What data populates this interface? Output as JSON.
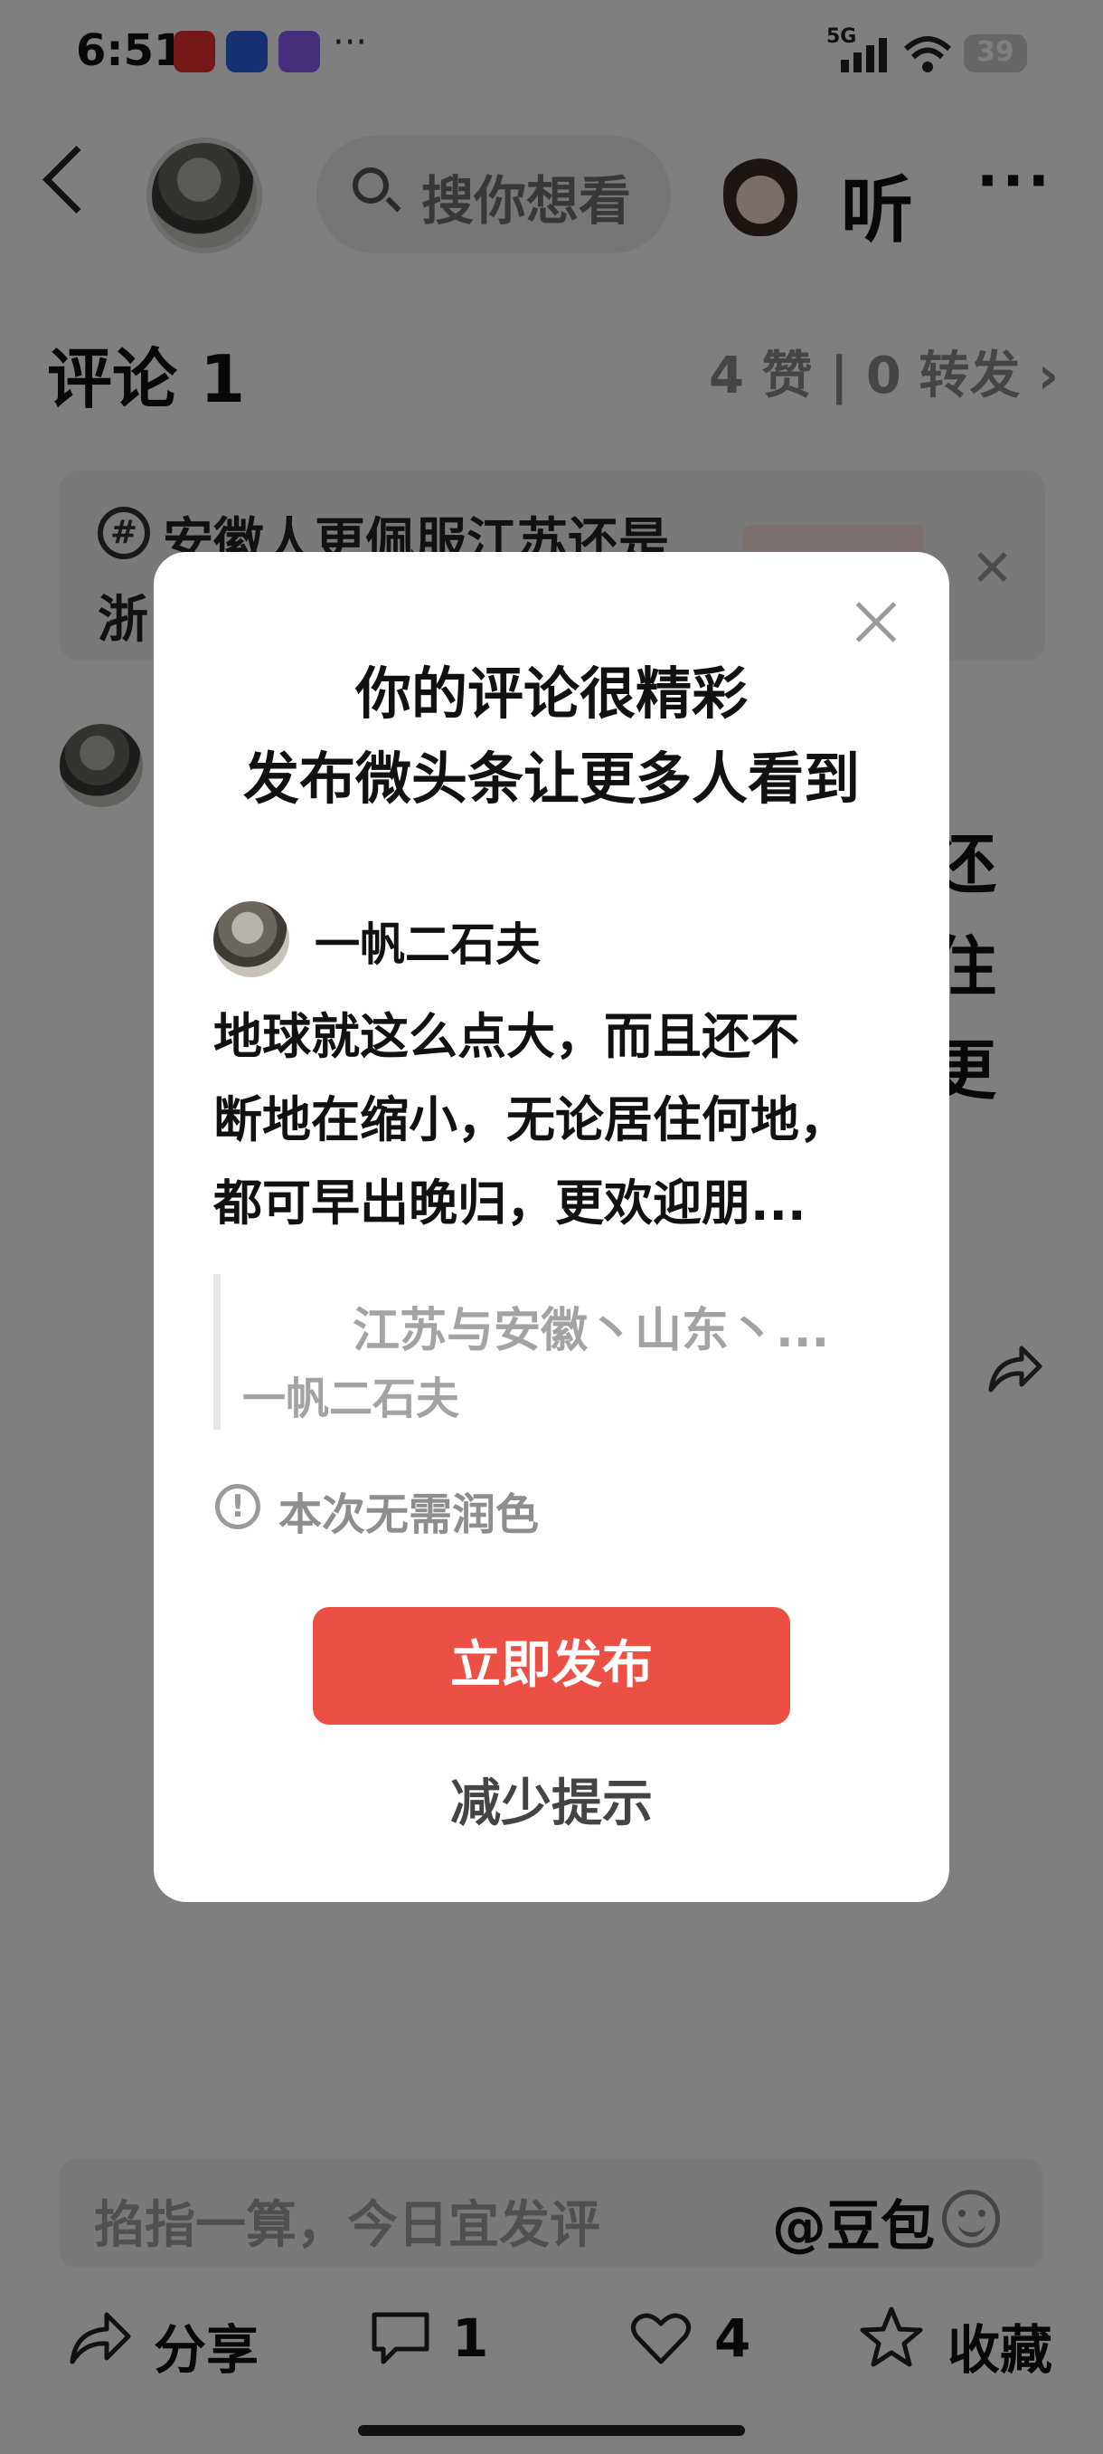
{
  "status_bar": {
    "time": "6:51",
    "app_icons": [
      "toutiao-icon",
      "baidu-icon",
      "upload-icon"
    ],
    "network": "5G",
    "battery": "39"
  },
  "nav": {
    "search_placeholder": "搜你想看",
    "listen_label": "听",
    "more_label": "···"
  },
  "comments": {
    "title": "评论 1",
    "stats": "4 赞 | 0 转发 ›"
  },
  "topic": {
    "line1": "安徽人更佩服江苏还是",
    "line2": "浙"
  },
  "input": {
    "placeholder": "掐指一算，今日宜发评",
    "mention": "@豆包"
  },
  "actions": [
    {
      "label": "分享",
      "icon": "share-icon"
    },
    {
      "label": "1",
      "icon": "comment-icon"
    },
    {
      "label": "4",
      "icon": "heart-icon"
    },
    {
      "label": "收藏",
      "icon": "star-icon"
    }
  ],
  "dialog": {
    "title_line1": "你的评论很精彩",
    "title_line2": "发布微头条让更多人看到",
    "username": "一帆二石夫",
    "body_line1": "地球就这么点大，而且还不",
    "body_line2": "断地在缩小，无论居住何地，",
    "body_line3": "都可早出晚归，更欢迎朋...",
    "quote_line1": "江苏与安徽丶山东丶...",
    "quote_line2": "一帆二石夫",
    "info": "本次无需润色",
    "publish_button": "立即发布",
    "reduce_button": "减少提示"
  },
  "colors": {
    "primary_button": "#ec5045",
    "overlay": "rgba(0,0,0,0.5)"
  }
}
